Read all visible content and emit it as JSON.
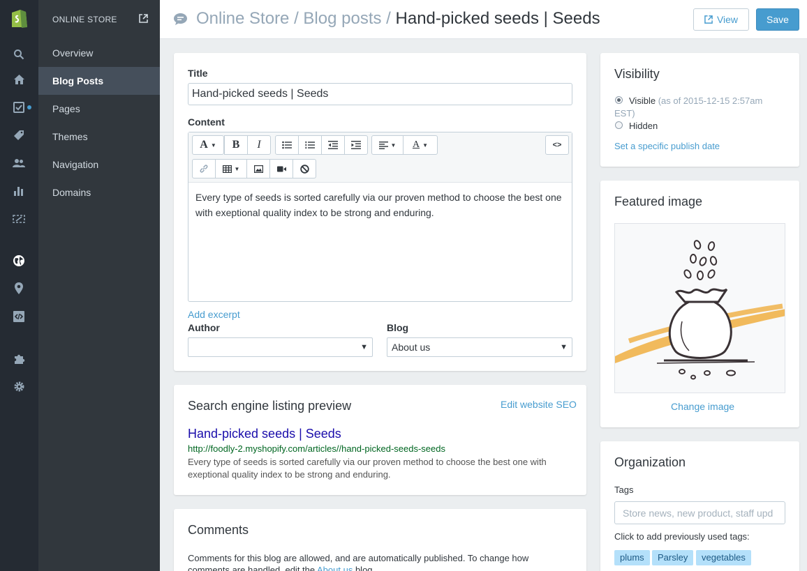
{
  "subnav": {
    "header": "ONLINE STORE",
    "items": [
      {
        "label": "Overview"
      },
      {
        "label": "Blog Posts"
      },
      {
        "label": "Pages"
      },
      {
        "label": "Themes"
      },
      {
        "label": "Navigation"
      },
      {
        "label": "Domains"
      }
    ]
  },
  "header": {
    "crumb1": "Online Store",
    "sep": "/",
    "crumb2": "Blog posts",
    "current": "Hand-picked seeds | Seeds",
    "view_label": "View",
    "save_label": "Save"
  },
  "post": {
    "title_label": "Title",
    "title_value": "Hand-picked seeds | Seeds",
    "content_label": "Content",
    "content_text": "Every type of seeds is sorted carefully via our proven method to choose the best one with exeptional quality index to be strong and enduring.",
    "add_excerpt": "Add excerpt",
    "author_label": "Author",
    "author_value": "",
    "blog_label": "Blog",
    "blog_value": "About us"
  },
  "seo": {
    "heading": "Search engine listing preview",
    "edit_link": "Edit website SEO",
    "title": "Hand-picked seeds | Seeds",
    "url": "http://foodly-2.myshopify.com/articles//hand-picked-seeds-seeds",
    "description": "Every type of seeds is sorted carefully via our proven method to choose the best one with exeptional quality index to be strong and enduring."
  },
  "comments": {
    "heading": "Comments",
    "text_before": "Comments for this blog are allowed, and are automatically published. To change how comments are handled, edit the ",
    "link": "About us",
    "text_after": " blog."
  },
  "visibility": {
    "heading": "Visibility",
    "visible_label": "Visible",
    "visible_note": "(as of 2015-12-15 2:57am",
    "visible_note2": "EST)",
    "hidden_label": "Hidden",
    "publish_link": "Set a specific publish date",
    "selected": "visible"
  },
  "featured": {
    "heading": "Featured image",
    "change_link": "Change image"
  },
  "organization": {
    "heading": "Organization",
    "tags_label": "Tags",
    "tags_placeholder": "Store news, new product, staff upd",
    "hint": "Click to add previously used tags:",
    "tags": [
      "plums",
      "Parsley",
      "vegetables"
    ]
  },
  "colors": {
    "accent": "#479ccf",
    "sidebar": "#31373d",
    "rail": "#252b33",
    "tag_bg": "#b4e0fa"
  },
  "icons": {
    "rail": [
      "shopify-logo-icon",
      "search-icon",
      "home-icon",
      "orders-icon",
      "tag-icon",
      "customers-icon",
      "reports-icon",
      "discounts-icon",
      "online-store-icon",
      "location-icon",
      "code-icon",
      "apps-icon",
      "settings-icon"
    ]
  }
}
